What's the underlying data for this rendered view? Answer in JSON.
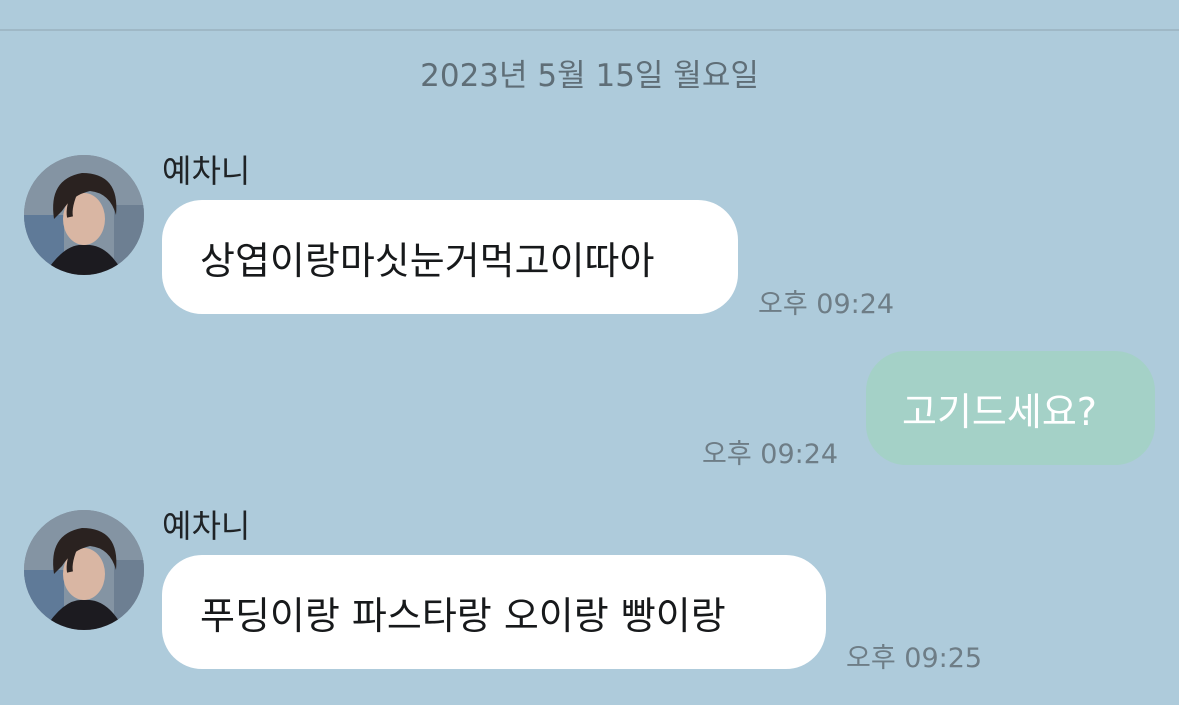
{
  "date_separator": "2023년 5월 15일 월요일",
  "messages": [
    {
      "direction": "incoming",
      "sender": "예차니",
      "text": "상엽이랑마싯눈거먹고이따아",
      "time": "오후 09:24"
    },
    {
      "direction": "outgoing",
      "text": "고기드세요?",
      "time": "오후 09:24"
    },
    {
      "direction": "incoming",
      "sender": "예차니",
      "text": "푸딩이랑 파스타랑 오이랑 빵이랑",
      "time": "오후 09:25"
    }
  ],
  "colors": {
    "background": "#aecbdb",
    "incoming_bubble": "#ffffff",
    "outgoing_bubble": "#a4d1c7"
  }
}
